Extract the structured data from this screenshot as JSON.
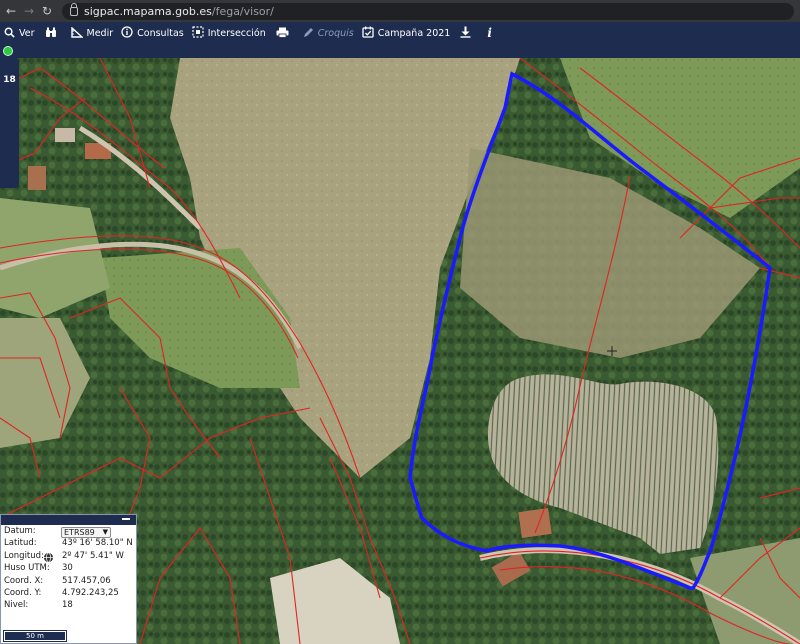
{
  "browser": {
    "url_host": "sigpac.mapama.gob.es",
    "url_path": "/fega/visor/"
  },
  "toolbar": {
    "items": [
      {
        "label": "Ver",
        "icon": "search-icon"
      },
      {
        "label": "",
        "icon": "binoculars-icon"
      },
      {
        "label": "Medir",
        "icon": "ruler-icon"
      },
      {
        "label": "Consultas",
        "icon": "info-circle-icon"
      },
      {
        "label": "Intersección",
        "icon": "intersection-icon"
      },
      {
        "label": "",
        "icon": "print-icon"
      },
      {
        "label": "Croquis",
        "icon": "pencil-icon"
      },
      {
        "label": "Campaña 2021",
        "icon": "calendar-check-icon"
      },
      {
        "label": "",
        "icon": "download-icon"
      },
      {
        "label": "",
        "icon": "info-icon"
      }
    ]
  },
  "zoom": {
    "level": "18"
  },
  "coords": {
    "datum_label": "Datum:",
    "datum_value": "ETRS89",
    "lat_label": "Latitud:",
    "lat_value": "43º 16' 58.10\" N",
    "lon_label": "Longitud:",
    "lon_value": "2º 47' 5.41\" W",
    "huso_label": "Huso UTM:",
    "huso_value": "30",
    "x_label": "Coord. X:",
    "x_value": "517.457,06",
    "y_label": "Coord. Y:",
    "y_value": "4.792.243,25",
    "nivel_label": "Nivel:",
    "nivel_value": "18",
    "scale": "50 m"
  },
  "colors": {
    "toolbar": "#1d2c4f",
    "parcel_lines": "#e02424",
    "sketch_outline": "#1a1aff",
    "status": "#2ec943"
  }
}
